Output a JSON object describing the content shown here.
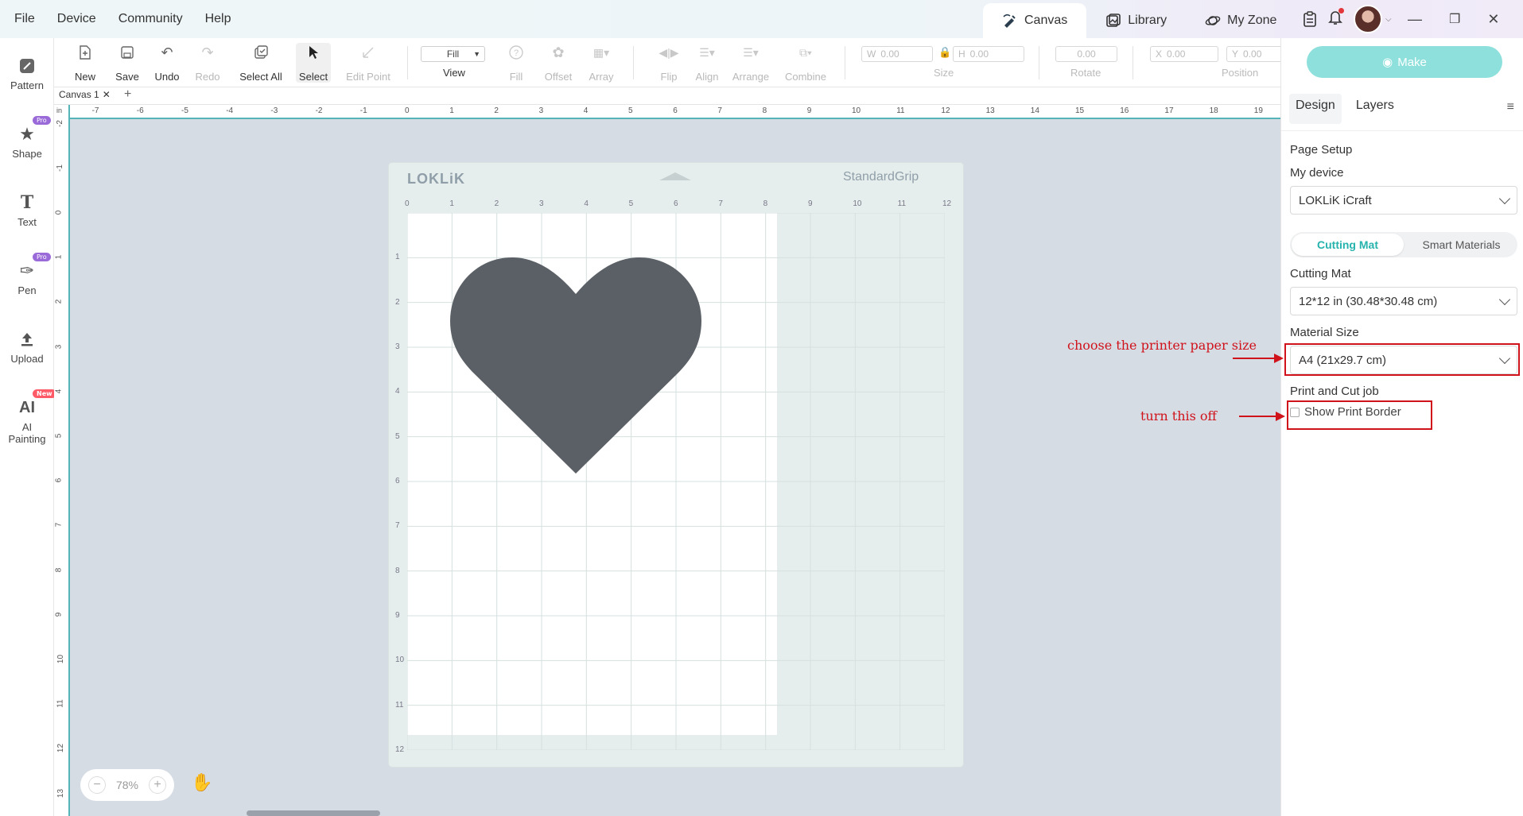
{
  "menu": [
    "File",
    "Device",
    "Community",
    "Help"
  ],
  "nav_tabs": {
    "canvas": "Canvas",
    "library": "Library",
    "my_zone": "My Zone"
  },
  "rail": [
    {
      "id": "pattern",
      "label": "Pattern",
      "icon": "pattern-icon"
    },
    {
      "id": "shape",
      "label": "Shape",
      "icon": "star-icon",
      "badge": "Pro"
    },
    {
      "id": "text",
      "label": "Text",
      "icon": "text-icon"
    },
    {
      "id": "pen",
      "label": "Pen",
      "icon": "pen-icon",
      "badge": "Pro"
    },
    {
      "id": "upload",
      "label": "Upload",
      "icon": "upload-icon"
    },
    {
      "id": "ai",
      "label": "AI\nPainting",
      "label_line1": "AI",
      "label_line2": "Painting",
      "icon": "ai-icon",
      "badge": "New"
    }
  ],
  "toolbar": {
    "new": "New",
    "save": "Save",
    "undo": "Undo",
    "redo": "Redo",
    "select_all": "Select All",
    "select": "Select",
    "edit_point": "Edit Point",
    "fill_value": "Fill",
    "view": "View",
    "fill": "Fill",
    "offset": "Offset",
    "array": "Array",
    "flip": "Flip",
    "align": "Align",
    "arrange": "Arrange",
    "combine": "Combine",
    "w_label": "W",
    "w_value": "0.00",
    "h_label": "H",
    "h_value": "0.00",
    "size": "Size",
    "rotate_value": "0.00",
    "rotate": "Rotate",
    "x_label": "X",
    "x_value": "0.00",
    "y_label": "Y",
    "y_value": "0.00",
    "position": "Position"
  },
  "canvas_tab": "Canvas 1",
  "ruler_unit": "in",
  "ruler_h": [
    "-7",
    "-6",
    "-5",
    "-4",
    "-3",
    "-2",
    "-1",
    "0",
    "1",
    "2",
    "3",
    "4",
    "5",
    "6",
    "7",
    "8",
    "9",
    "10",
    "11",
    "12",
    "13",
    "14",
    "15",
    "16",
    "17",
    "18",
    "19"
  ],
  "ruler_v": [
    "-2",
    "-1",
    "0",
    "1",
    "2",
    "3",
    "4",
    "5",
    "6",
    "7",
    "8",
    "9",
    "10",
    "11",
    "12",
    "13"
  ],
  "mat": {
    "logo": "LOKLiK",
    "grip": "StandardGrip",
    "cols": [
      "0",
      "1",
      "2",
      "3",
      "4",
      "5",
      "6",
      "7",
      "8",
      "9",
      "10",
      "11",
      "12"
    ],
    "rows": [
      "1",
      "2",
      "3",
      "4",
      "5",
      "6",
      "7",
      "8",
      "9",
      "10",
      "11",
      "12"
    ],
    "shape_color": "#5b6066"
  },
  "zoom": "78%",
  "panel": {
    "make": "Make",
    "tab_design": "Design",
    "tab_layers": "Layers",
    "page_setup": "Page Setup",
    "my_device_label": "My device",
    "my_device_value": "LOKLiK iCraft",
    "seg_mat": "Cutting Mat",
    "seg_smart": "Smart Materials",
    "cutting_mat_label": "Cutting Mat",
    "cutting_mat_value": "12*12 in (30.48*30.48 cm)",
    "material_size_label": "Material Size",
    "material_size_value": "A4 (21x29.7 cm)",
    "print_cut_label": "Print and Cut job",
    "show_print_border": "Show Print Border"
  },
  "annotations": {
    "paper_size": "choose the printer paper size",
    "turn_off": "turn this off",
    "color": "#d0121b"
  },
  "colors": {
    "accent": "#27b3ad",
    "make_button": "#8ee0dc",
    "ruler_line": "#55b4b8"
  }
}
